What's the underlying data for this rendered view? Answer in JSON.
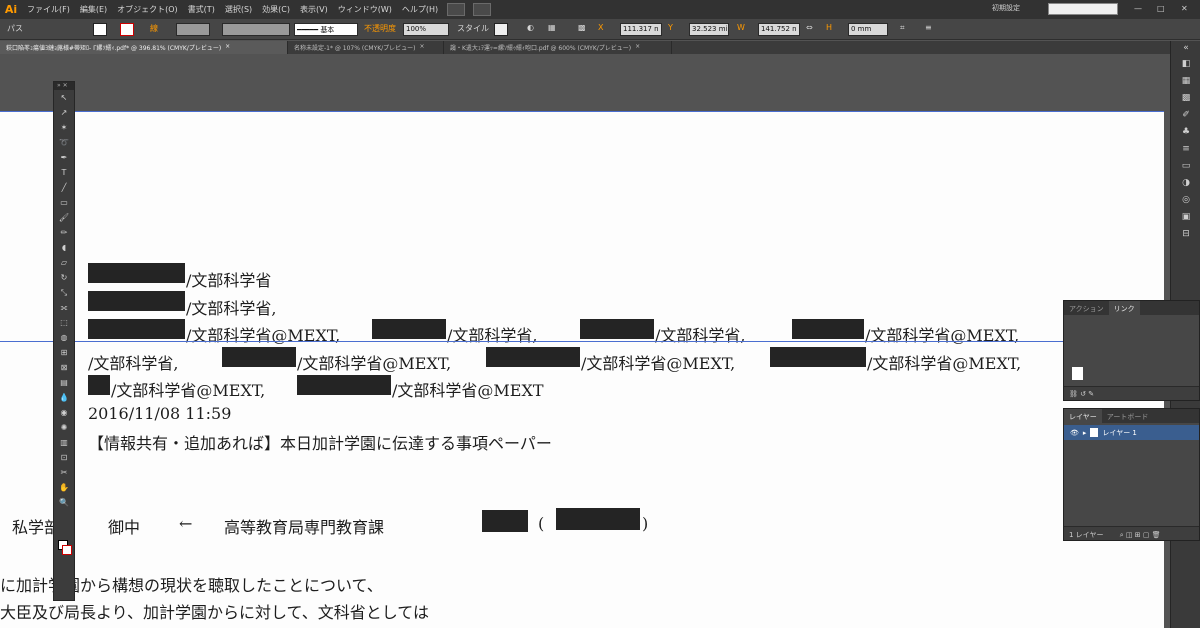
{
  "app": {
    "logo": "Ai",
    "workspace": "初期設定"
  },
  "menu": [
    "ファイル(F)",
    "編集(E)",
    "オブジェクト(O)",
    "書式(T)",
    "選択(S)",
    "効果(C)",
    "表示(V)",
    "ウィンドウ(W)",
    "ヘルプ(H)"
  ],
  "controlbar": {
    "selection_label": "パス",
    "stroke_label": "線",
    "stroke_style": "基本",
    "opacity_label": "不透明度",
    "opacity_value": "100%",
    "style_label": "スタイル",
    "x_label": "X",
    "x_value": "111.317 n",
    "y_label": "Y",
    "y_value": "32.523 mi",
    "w_label": "W",
    "w_value": "141.752 n",
    "h_label": "H",
    "h_value": "0 mm"
  },
  "tabs": [
    {
      "label": "萩口陥苳ｭ瘍値ﾖ縺ｮ蕗様#蒂矩ﾛ- Γ縲ｿ繧ｨ.pdf* @ 396.81% (CMYK/プレビュー)",
      "close": "×"
    },
    {
      "label": "名称未設定-1* @ 107% (CMYK/プレビュー)",
      "close": "×"
    },
    {
      "label": "讒・K遣大ｭｦ運ｯ=縲ｿ繧ｩ繧ｨ咆口.pdf @ 600% (CMYK/プレビュー)",
      "close": "×"
    }
  ],
  "document": {
    "lines": [
      "/文部科学省",
      "/文部科学省,",
      "/文部科学省@MEXT,",
      "/文部科学省,",
      "/文部科学省,",
      "/文部科学省@MEXT,",
      "/文部科学省,",
      "/文部科学省@MEXT,",
      "/文部科学省@MEXT,",
      "/文部科学省@MEXT,",
      "/文部科学省@MEXT,",
      "/文部科学省@MEXT",
      "2016/11/08 11:59",
      "【情報共有・追加あれば】本日加計学園に伝達する事項ペーパー",
      "私学部",
      "御中",
      "←",
      "高等教育局専門教育課",
      "(",
      ")",
      "に加計学園から構想の現状を聴取したことについて、",
      "大臣及び局長より、加計学園からに対して、文科省としては"
    ]
  },
  "panels": {
    "links": {
      "tabs": [
        "アクション",
        "リンク"
      ]
    },
    "layers": {
      "tabs": [
        "レイヤー",
        "アートボード"
      ],
      "layer_name": "レイヤー 1",
      "footer": "1 レイヤー"
    }
  }
}
